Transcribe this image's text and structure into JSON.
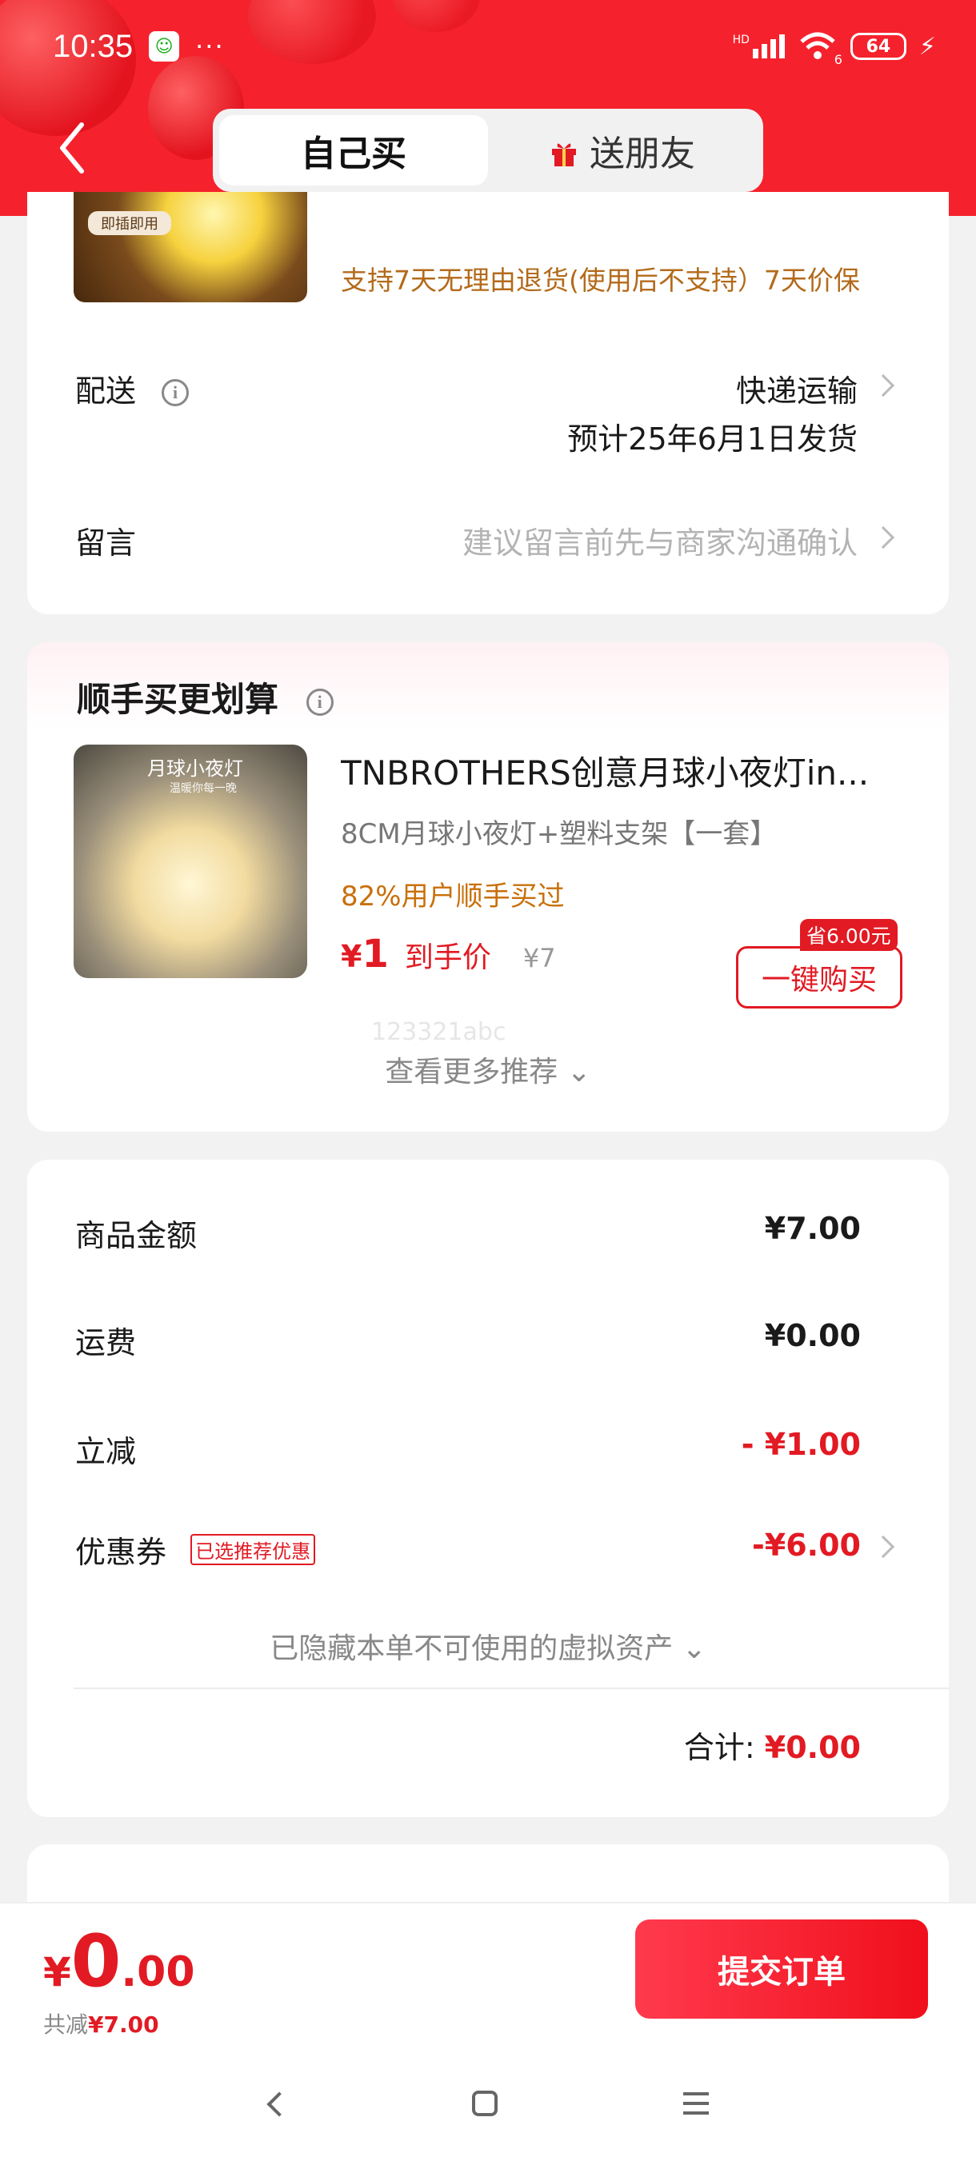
{
  "status_bar": {
    "time": "10:35",
    "dots": "···",
    "network": "HD",
    "wifi_label": "6",
    "battery": "64"
  },
  "header": {
    "tabs": [
      {
        "label": "自己买",
        "active": true
      },
      {
        "label": "送朋友",
        "active": false
      }
    ]
  },
  "order": {
    "thumb_tag": "即插即用",
    "guarantee": "支持7天无理由退货(使用后不支持）7天价保",
    "delivery": {
      "label": "配送",
      "method": "快递运输",
      "estimate": "预计25年6月1日发货"
    },
    "remark": {
      "label": "留言",
      "placeholder": "建议留言前先与商家沟通确认"
    }
  },
  "upsell": {
    "title": "顺手买更划算",
    "product": {
      "thumb_text": "月球小夜灯",
      "thumb_sub": "温暖你每一晚",
      "name": "TNBROTHERS创意月球小夜灯in...",
      "spec": "8CM月球小夜灯+塑料支架【一套】",
      "stat": "82%用户顺手买过",
      "price_symbol": "¥",
      "price": "1",
      "price_label": "到手价",
      "original_price": "¥7",
      "save_tag": "省6.00元",
      "buy_label": "一键购买"
    },
    "watermark": "123321abc",
    "more_label": "查看更多推荐 ⌄"
  },
  "summary": {
    "goods": {
      "label": "商品金额",
      "value": "¥7.00"
    },
    "shipping": {
      "label": "运费",
      "value": "¥0.00"
    },
    "discount": {
      "label": "立减",
      "value": "- ¥1.00"
    },
    "coupon": {
      "label": "优惠券",
      "tag": "已选推荐优惠",
      "value": "-¥6.00"
    },
    "hidden_assets": "已隐藏本单不可使用的虚拟资产 ⌄",
    "total_label": "合计:",
    "total_value": "¥0.00"
  },
  "bottom": {
    "pay_symbol": "¥",
    "pay_int": "0",
    "pay_dec": ".00",
    "saved_label": "共减",
    "saved_value": "¥7.00",
    "submit_label": "提交订单"
  },
  "colors": {
    "brand_red": "#f5222d",
    "price_red": "#e21a23",
    "accent_orange": "#c8700a"
  }
}
